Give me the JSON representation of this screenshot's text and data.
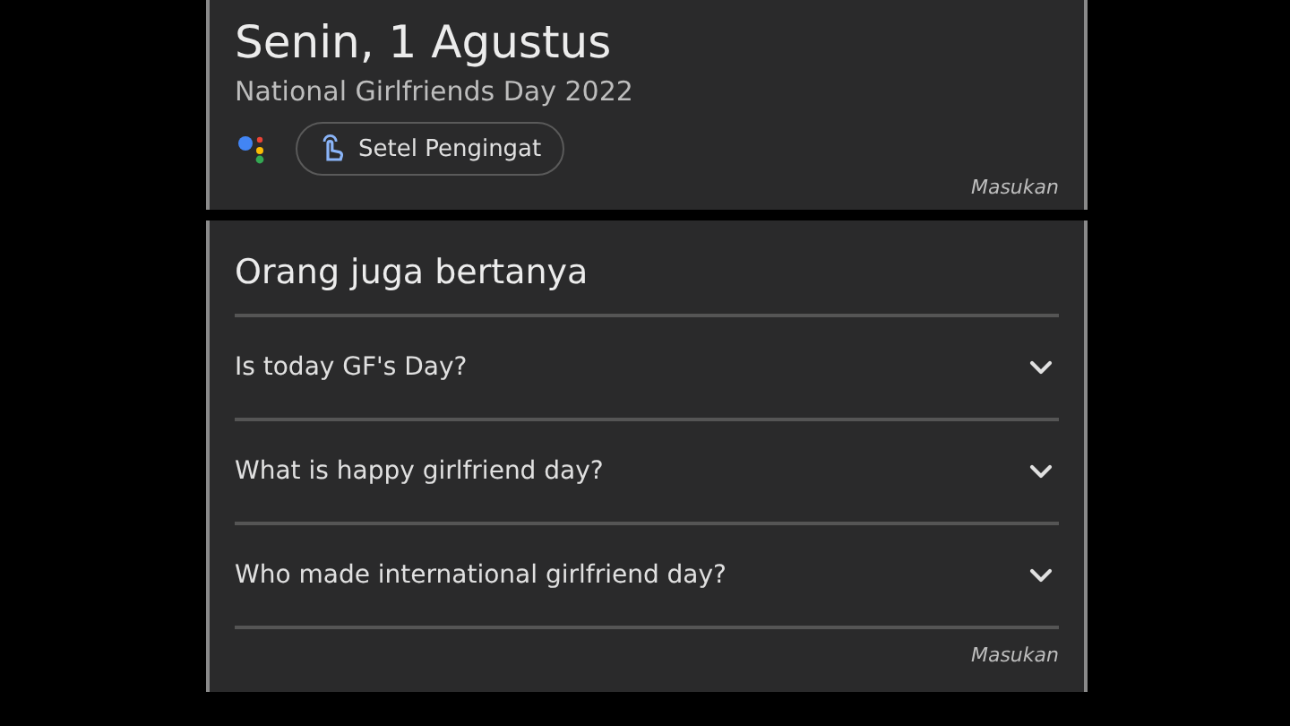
{
  "event_card": {
    "date": "Senin, 1 Agustus",
    "event": "National Girlfriends Day 2022",
    "reminder_button": "Setel Pengingat",
    "feedback": "Masukan"
  },
  "people_also_ask": {
    "title": "Orang juga bertanya",
    "questions": [
      {
        "text": "Is today GF's Day?",
        "expanded": false
      },
      {
        "text": "What is happy girlfriend day?",
        "expanded": false
      },
      {
        "text": "Who made international girlfriend day?",
        "expanded": false
      }
    ],
    "feedback": "Masukan"
  }
}
